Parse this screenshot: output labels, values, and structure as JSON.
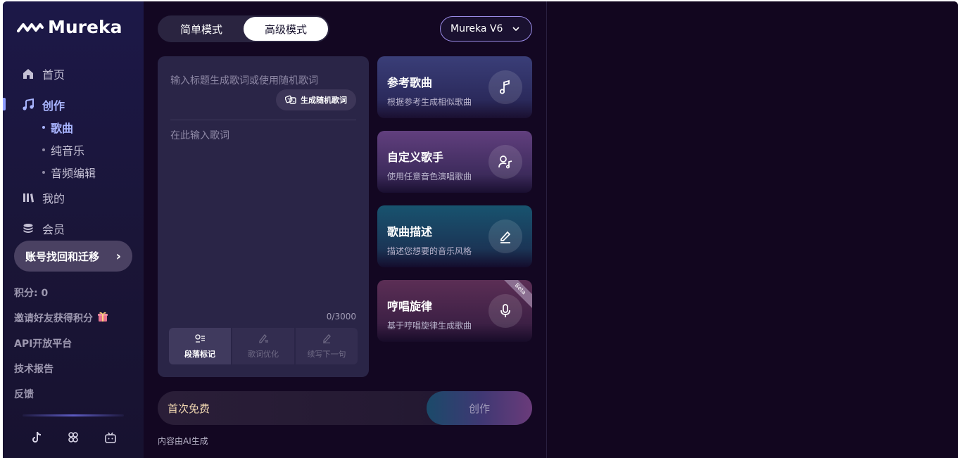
{
  "brand": {
    "name": "Mureka"
  },
  "nav": {
    "home": "首页",
    "create": "创作",
    "sub": [
      "歌曲",
      "纯音乐",
      "音频编辑"
    ],
    "mine": "我的",
    "member": "会员"
  },
  "account_button": {
    "label": "账号找回和迁移",
    "chevron": "›"
  },
  "side_links": {
    "points": "积分: 0",
    "invite": "邀请好友获得积分",
    "api": "API开放平台",
    "report": "技术报告",
    "feedback": "反馈"
  },
  "mode_toggle": {
    "simple": "简单模式",
    "advanced": "高级模式",
    "selected": "高级模式"
  },
  "model_select": {
    "value": "Mureka V6"
  },
  "lyrics": {
    "title_placeholder": "输入标题生成歌词或使用随机歌词",
    "random_button": "生成随机歌词",
    "lyrics_placeholder": "在此输入歌词",
    "char_count": "0/3000",
    "tools": [
      "段落标记",
      "歌词优化",
      "续写下一句"
    ]
  },
  "cards": [
    {
      "title": "参考歌曲",
      "subtitle": "根据参考生成相似歌曲",
      "icon": "music-note-icon"
    },
    {
      "title": "自定义歌手",
      "subtitle": "使用任意音色演唱歌曲",
      "icon": "singer-icon"
    },
    {
      "title": "歌曲描述",
      "subtitle": "描述您想要的音乐风格",
      "icon": "pencil-icon"
    },
    {
      "title": "哼唱旋律",
      "subtitle": "基于哼唱旋律生成歌曲",
      "icon": "microphone-icon",
      "badge": "Beta"
    }
  ],
  "create_bar": {
    "free_text": "首次免费",
    "button": "创作"
  },
  "ai_note": "内容由AI生成",
  "colors": {
    "accent": "#a9b5ff",
    "background": "#12061f",
    "sidebar": "#1c1848"
  }
}
